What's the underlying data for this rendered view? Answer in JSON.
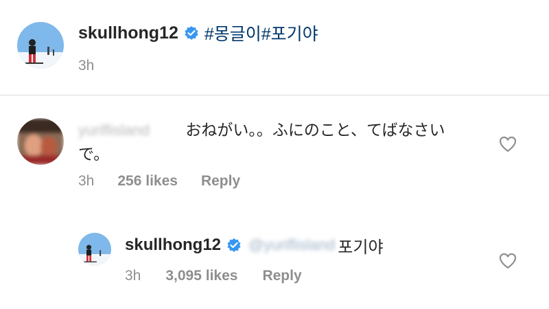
{
  "post": {
    "username": "skullhong12",
    "caption": "#몽글이#포기야",
    "time": "3h"
  },
  "comment": {
    "username": "yuriflisland",
    "text_line1": "おねがい。。ふにのこと、てばなさい",
    "text_line2": "で。",
    "time": "3h",
    "likes": "256 likes",
    "reply_label": "Reply"
  },
  "reply": {
    "username": "skullhong12",
    "mention": "@yuriflisland",
    "text": "포기야",
    "time": "3h",
    "likes": "3,095 likes",
    "reply_label": "Reply"
  },
  "icons": {
    "verified": "verified-badge-icon",
    "like": "heart-outline-icon"
  },
  "colors": {
    "verified_blue": "#3897f0",
    "hashtag": "#00376b",
    "meta_gray": "#8e8e8e",
    "divider": "#dbdbdb"
  }
}
